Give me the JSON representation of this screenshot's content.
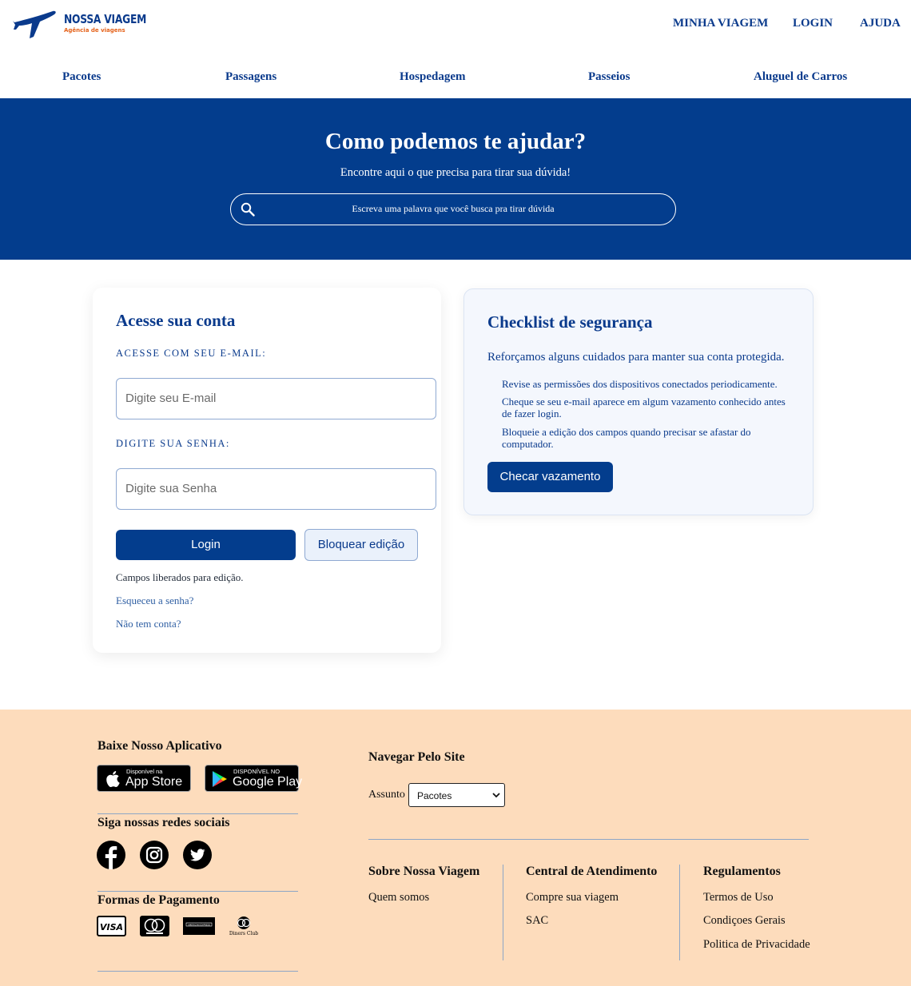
{
  "brand": {
    "name": "NOSSA VIAGEM",
    "tagline": "Agência de viagens"
  },
  "top_nav": [
    "MINHA VIAGEM",
    "LOGIN",
    "AJUDA"
  ],
  "main_nav": [
    "Pacotes",
    "Passagens",
    "Hospedagem",
    "Passeios",
    "Aluguel de Carros"
  ],
  "hero": {
    "title": "Como podemos te ajudar?",
    "subtitle": "Encontre aqui o que precisa para tirar sua dúvida!",
    "search_placeholder": "Escreva uma palavra que você busca pra tirar dúvida"
  },
  "login": {
    "title": "Acesse sua conta",
    "email_label": "ACESSE COM SEU E-MAIL:",
    "email_placeholder": "Digite seu E-mail",
    "password_label": "DIGITE SUA SENHA:",
    "password_placeholder": "Digite sua Senha",
    "login_button": "Login",
    "lock_button": "Bloquear edição",
    "status": "Campos liberados para edição.",
    "forgot_link": "Esqueceu a senha?",
    "signup_link": "Não tem conta?"
  },
  "checklist": {
    "title": "Checklist de segurança",
    "intro": "Reforçamos alguns cuidados para manter sua conta protegida.",
    "items": [
      "Revise as permissões dos dispositivos conectados periodicamente.",
      "Cheque se seu e-mail aparece em algum vazamento conhecido antes de fazer login.",
      "Bloqueie a edição dos campos quando precisar se afastar do computador."
    ],
    "button": "Checar vazamento"
  },
  "footer": {
    "app_title": "Baixe Nosso Aplicativo",
    "app_store": {
      "small": "Disponível na",
      "big": "App Store"
    },
    "google_play": {
      "small": "DISPONÍVEL NO",
      "big": "Google Play"
    },
    "social_title": "Siga nossas redes sociais",
    "social_icons": [
      "facebook-icon",
      "instagram-icon",
      "twitter-icon"
    ],
    "payment_title": "Formas de Pagamento",
    "payment_icons": [
      "visa-icon",
      "mastercard-icon",
      "american-express-icon",
      "diners-club-icon"
    ],
    "payment_marks": {
      "visa": "VISA",
      "amex": "AMERICAN EXPRESS",
      "diners": "Diners Club"
    },
    "navigate_title": "Navegar Pelo Site",
    "subject_label": "Assunto",
    "subject_selected": "Pacotes",
    "columns": [
      {
        "title": "Sobre Nossa Viagem",
        "links": [
          "Quem somos"
        ]
      },
      {
        "title": "Central de Atendimento",
        "links": [
          "Compre sua viagem",
          "SAC"
        ]
      },
      {
        "title": "Regulamentos",
        "links": [
          "Termos de Uso",
          "Condiçoes Gerais",
          "Politica de Privacidade"
        ]
      }
    ]
  },
  "colors": {
    "primary": "#033d8d",
    "footer_bg": "#fddcbc",
    "accent": "#e5621a"
  }
}
